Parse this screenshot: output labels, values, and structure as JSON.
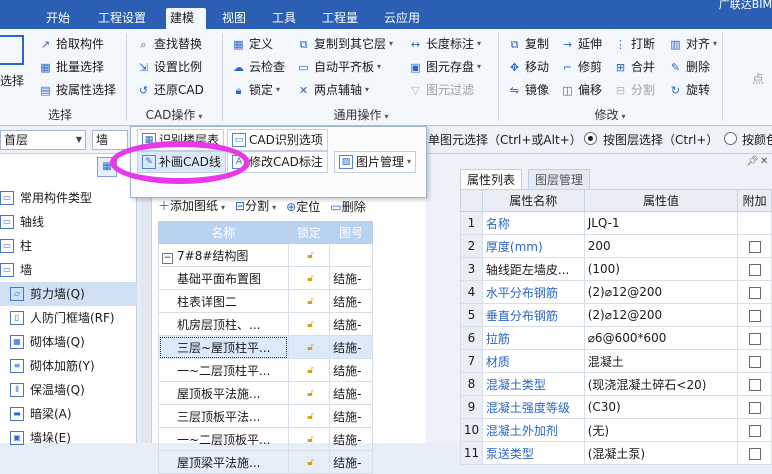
{
  "topbar": {
    "tabs": [
      "开始",
      "工程设置",
      "建模",
      "视图",
      "工具",
      "工程量",
      "云应用"
    ],
    "active_tab": "建模",
    "corner_text": "广联达BIM"
  },
  "ribbon": {
    "select_group": {
      "big_button": "选择",
      "items": [
        "拾取构件",
        "批量选择",
        "按属性选择"
      ],
      "label": "选择"
    },
    "cad_group": {
      "items": [
        "查找替换",
        "设置比例",
        "还原CAD"
      ],
      "label": "CAD操作"
    },
    "general_group": {
      "col1": [
        "定义",
        "云检查",
        "锁定"
      ],
      "col2": [
        "复制到其它层",
        "自动平齐板",
        "两点辅轴"
      ],
      "col3": [
        "长度标注",
        "图元存盘",
        "图元过滤"
      ],
      "label": "通用操作"
    },
    "modify_group": {
      "col1": [
        "复制",
        "移动",
        "镜像"
      ],
      "col2": [
        "延伸",
        "修剪",
        "偏移"
      ],
      "col3": [
        "打断",
        "合并",
        "分割"
      ],
      "col4": [
        "对齐",
        "删除",
        "旋转"
      ],
      "label": "修改"
    },
    "right_partial": "点"
  },
  "cad_panel": {
    "row1": [
      "识别楼层表",
      "CAD识别选项"
    ],
    "row2": [
      "补画CAD线",
      "修改CAD标注",
      "图片管理"
    ]
  },
  "selector_bar": {
    "floor_combo": "首层",
    "type_combo": "墙",
    "single_select": "单图元选择（Ctrl+或Alt+）",
    "layer_select": "按图层选择（Ctrl+）",
    "color_select": "按颜色"
  },
  "left_tree": {
    "items": [
      "常用构件类型",
      "轴线",
      "柱",
      "墙",
      "剪力墙(Q)",
      "人防门框墙(RF)",
      "砌体墙(Q)",
      "砌体加筋(Y)",
      "保温墙(Q)",
      "暗梁(A)",
      "墙垛(E)"
    ],
    "selected": "剪力墙(Q)"
  },
  "drawing_list": {
    "toolbar": [
      "添加图纸",
      "分割",
      "定位",
      "删除"
    ],
    "headers": [
      "名称",
      "锁定",
      "图号"
    ],
    "root": "7#8#结构图",
    "rows": [
      {
        "name": "基础平面布置图",
        "code": "结施-"
      },
      {
        "name": "柱表详图二",
        "code": "结施-"
      },
      {
        "name": "机房层顶柱、...",
        "code": "结施-"
      },
      {
        "name": "三层~屋顶柱平...",
        "code": "结施-"
      },
      {
        "name": "一~二层顶柱平...",
        "code": "结施-"
      },
      {
        "name": "屋顶板平法施...",
        "code": "结施-"
      },
      {
        "name": "三层顶板平法...",
        "code": "结施-"
      },
      {
        "name": "一~二层顶板平...",
        "code": "结施-"
      },
      {
        "name": "屋顶梁平法施...",
        "code": "结施-"
      }
    ],
    "selected_index": 3
  },
  "properties": {
    "tabs": [
      "属性列表",
      "图层管理"
    ],
    "active_tab": "属性列表",
    "headers": [
      "属性名称",
      "属性值",
      "附加"
    ],
    "rows": [
      {
        "no": "1",
        "name": "名称",
        "value": "JLQ-1",
        "blue": true,
        "check": false
      },
      {
        "no": "2",
        "name": "厚度(mm)",
        "value": "200",
        "blue": true,
        "check": true
      },
      {
        "no": "3",
        "name": "轴线距左墙皮...",
        "value": "(100)",
        "blue": false,
        "check": true
      },
      {
        "no": "4",
        "name": "水平分布钢筋",
        "value": "(2)⌀12@200",
        "blue": true,
        "check": true
      },
      {
        "no": "5",
        "name": "垂直分布钢筋",
        "value": "(2)⌀12@200",
        "blue": true,
        "check": true
      },
      {
        "no": "6",
        "name": "拉筋",
        "value": "⌀6@600*600",
        "blue": true,
        "check": true
      },
      {
        "no": "7",
        "name": "材质",
        "value": "混凝土",
        "blue": true,
        "check": true
      },
      {
        "no": "8",
        "name": "混凝土类型",
        "value": "(现浇混凝土碎石<20)",
        "blue": true,
        "check": true
      },
      {
        "no": "9",
        "name": "混凝土强度等级",
        "value": "(C30)",
        "blue": true,
        "check": true
      },
      {
        "no": "10",
        "name": "混凝土外加剂",
        "value": "(无)",
        "blue": true,
        "check": true
      },
      {
        "no": "11",
        "name": "泵送类型",
        "value": "(混凝土泵)",
        "blue": true,
        "check": true
      }
    ]
  }
}
